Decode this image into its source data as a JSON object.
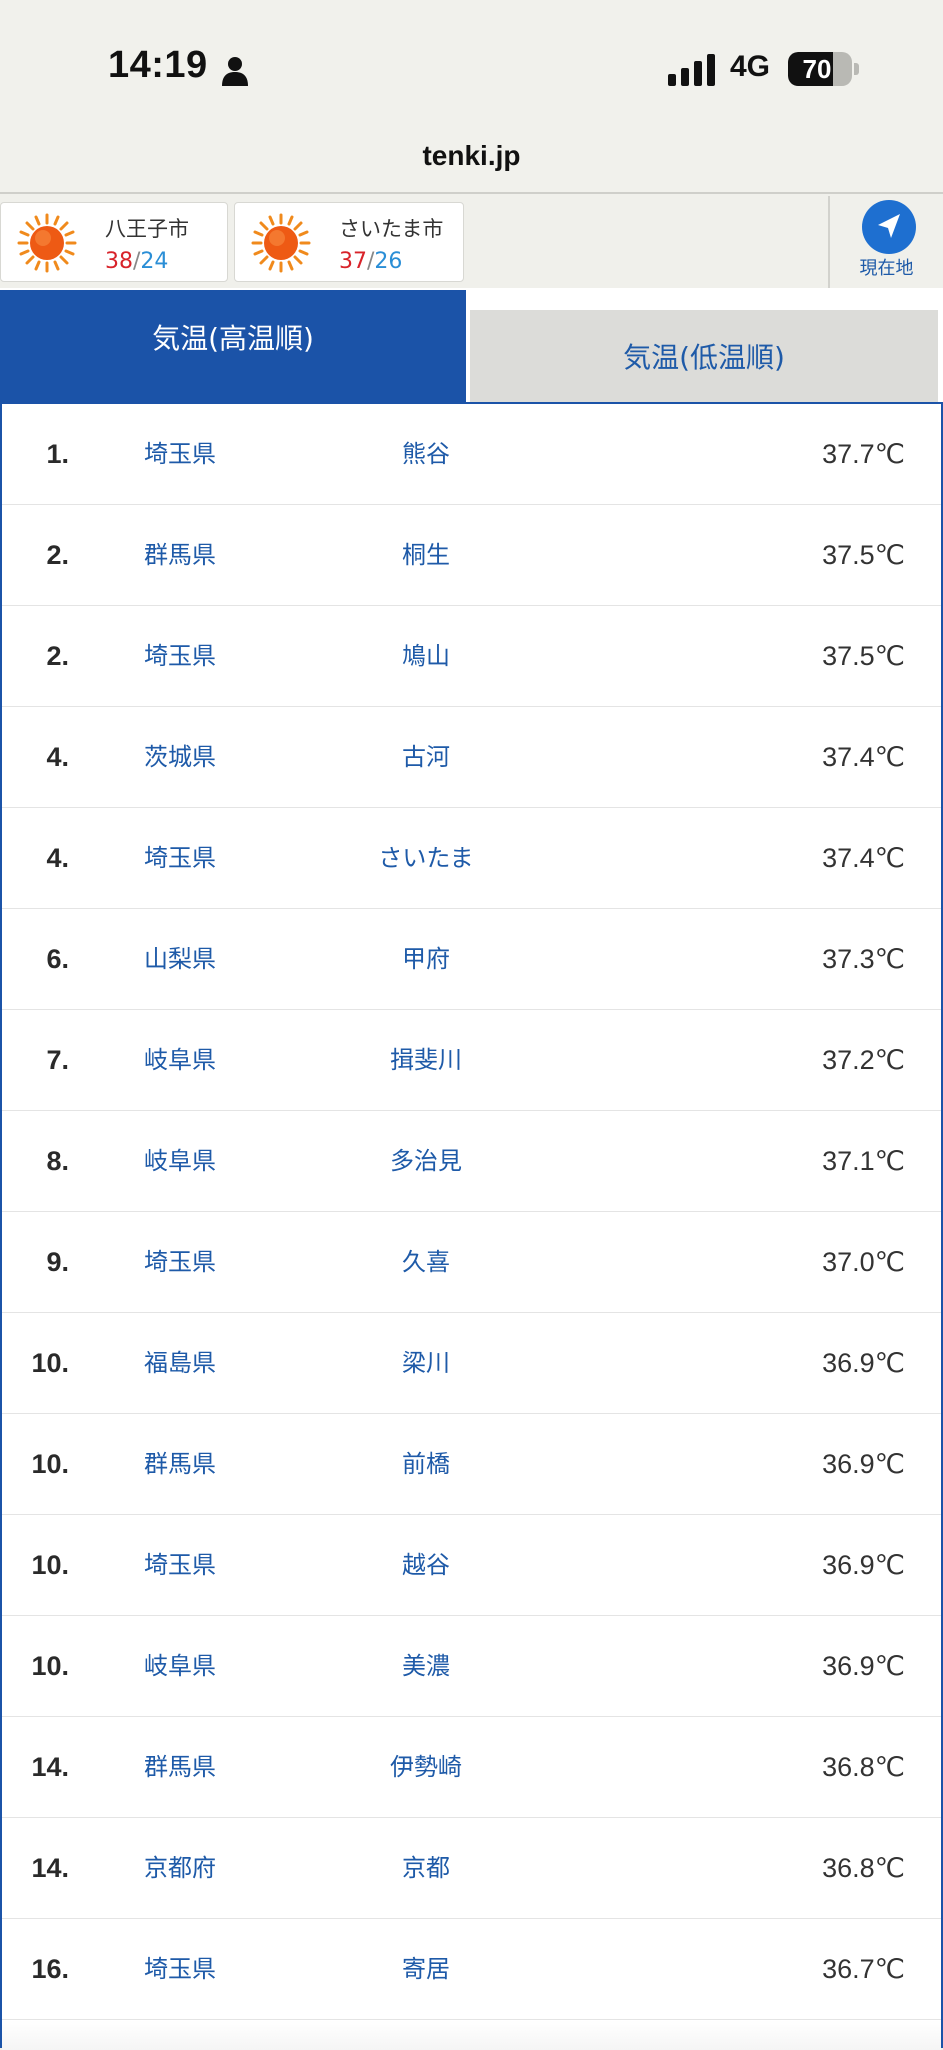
{
  "status_bar": {
    "time": "14:19",
    "network": "4G",
    "battery_percent": "70",
    "battery_level": 0.7
  },
  "browser": {
    "url": "tenki.jp"
  },
  "locations": [
    {
      "name": "八王子市",
      "high": "38",
      "low": "24",
      "separator": "/"
    },
    {
      "name": "さいたま市",
      "high": "37",
      "low": "26",
      "separator": "/"
    }
  ],
  "current_location_label": "現在地",
  "tabs": {
    "active": "気温(高温順)",
    "inactive": "気温(低温順)"
  },
  "colors": {
    "brand_blue": "#1b53a8",
    "high_temp": "#d8232a",
    "low_temp": "#2a8ed6"
  },
  "ranking": [
    {
      "rank": "1.",
      "prefecture": "埼玉県",
      "city": "熊谷",
      "temp": "37.7℃"
    },
    {
      "rank": "2.",
      "prefecture": "群馬県",
      "city": "桐生",
      "temp": "37.5℃"
    },
    {
      "rank": "2.",
      "prefecture": "埼玉県",
      "city": "鳩山",
      "temp": "37.5℃"
    },
    {
      "rank": "4.",
      "prefecture": "茨城県",
      "city": "古河",
      "temp": "37.4℃"
    },
    {
      "rank": "4.",
      "prefecture": "埼玉県",
      "city": "さいたま",
      "temp": "37.4℃"
    },
    {
      "rank": "6.",
      "prefecture": "山梨県",
      "city": "甲府",
      "temp": "37.3℃"
    },
    {
      "rank": "7.",
      "prefecture": "岐阜県",
      "city": "揖斐川",
      "temp": "37.2℃"
    },
    {
      "rank": "8.",
      "prefecture": "岐阜県",
      "city": "多治見",
      "temp": "37.1℃"
    },
    {
      "rank": "9.",
      "prefecture": "埼玉県",
      "city": "久喜",
      "temp": "37.0℃"
    },
    {
      "rank": "10.",
      "prefecture": "福島県",
      "city": "梁川",
      "temp": "36.9℃"
    },
    {
      "rank": "10.",
      "prefecture": "群馬県",
      "city": "前橋",
      "temp": "36.9℃"
    },
    {
      "rank": "10.",
      "prefecture": "埼玉県",
      "city": "越谷",
      "temp": "36.9℃"
    },
    {
      "rank": "10.",
      "prefecture": "岐阜県",
      "city": "美濃",
      "temp": "36.9℃"
    },
    {
      "rank": "14.",
      "prefecture": "群馬県",
      "city": "伊勢崎",
      "temp": "36.8℃"
    },
    {
      "rank": "14.",
      "prefecture": "京都府",
      "city": "京都",
      "temp": "36.8℃"
    },
    {
      "rank": "16.",
      "prefecture": "埼玉県",
      "city": "寄居",
      "temp": "36.7℃"
    }
  ]
}
